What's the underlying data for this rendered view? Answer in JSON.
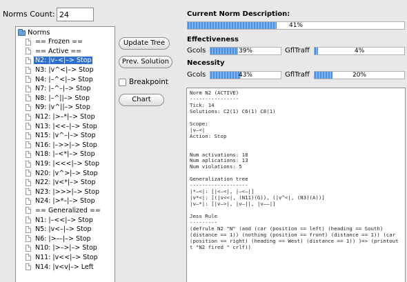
{
  "norms_count": {
    "label": "Norms Count:",
    "value": "24"
  },
  "tree": {
    "root_label": "Norms",
    "items": [
      {
        "label": "== Frozen ==",
        "selected": false
      },
      {
        "label": "== Active ==",
        "selected": false
      },
      {
        "label": "N2: |v–<|–> Stop",
        "selected": true
      },
      {
        "label": "N3: |v^<|–> Stop",
        "selected": false
      },
      {
        "label": "N4: |–^<|–> Stop",
        "selected": false
      },
      {
        "label": "N7: |–^–|–> Stop",
        "selected": false
      },
      {
        "label": "N8: |–^||–> Stop",
        "selected": false
      },
      {
        "label": "N9: |v^||–> Stop",
        "selected": false
      },
      {
        "label": "N12: |>–*|–> Stop",
        "selected": false
      },
      {
        "label": "N13: |<<–|–> Stop",
        "selected": false
      },
      {
        "label": "N15: |v^–|–> Stop",
        "selected": false
      },
      {
        "label": "N16: |–>>|–> Stop",
        "selected": false
      },
      {
        "label": "N18: |–<*|–> Stop",
        "selected": false
      },
      {
        "label": "N19: |<<<|–> Stop",
        "selected": false
      },
      {
        "label": "N20: |v^>|–> Stop",
        "selected": false
      },
      {
        "label": "N22: |v<*|–> Stop",
        "selected": false
      },
      {
        "label": "N23: |>>>|–> Stop",
        "selected": false
      },
      {
        "label": "N24: |>*–|–> Stop",
        "selected": false
      },
      {
        "label": "== Generalized ==",
        "selected": false
      },
      {
        "label": "N1: |–<<|–> Stop",
        "selected": false
      },
      {
        "label": "N5: |v<–|–> Stop",
        "selected": false
      },
      {
        "label": "N6: |>––|–> Stop",
        "selected": false
      },
      {
        "label": "N10: |>–>|–> Stop",
        "selected": false
      },
      {
        "label": "N11: |v<<|–> Stop",
        "selected": false
      },
      {
        "label": "N14: |v<v|–> Left",
        "selected": false
      }
    ]
  },
  "buttons": {
    "update_tree": "Update Tree",
    "prev_solution": "Prev. Solution",
    "chart": "Chart"
  },
  "breakpoint": {
    "label": "Breakpoint",
    "checked": false
  },
  "current_norm": {
    "title": "Current Norm Description:",
    "progress_text": "41%",
    "progress": 0.41
  },
  "effectiveness": {
    "title": "Effectiveness",
    "gcols": {
      "label": "Gcols",
      "text": "39%",
      "value": 0.39
    },
    "gfltraff": {
      "label": "GflTraff",
      "text": "4%",
      "value": 0.04
    }
  },
  "necessity": {
    "title": "Necessity",
    "gcols": {
      "label": "Gcols",
      "text": "43%",
      "value": 0.43
    },
    "gfltraff": {
      "label": "GflTraff",
      "text": "20%",
      "value": 0.2
    }
  },
  "description": {
    "text": "Norm N2 (ACTIVE)\n----------------\nTick: 14\nSolutions: C2(1) C6(1) C8(1)\n\nScope:\n|v–<|\nAction: Stop\n\n\nNum activations: 18\nNum aplications: 13\nNum violations: 5\n\nGeneralization tree\n-------------------\n|*–<|: [|<–<|, |–<–|]\n|v*<|: [(|v<<|, (N11)(G)), (|v^<|, (N3)(A))]\n|v–*|: [|v–>|, |v–||, |v––|]\n\nJess Rule\n---------\n(defrule N2 \"N\" (and (car (position == left) (heading == South) (distance == 1)) (nothing (position == front) (distance == 1)) (car (position == right) (heading == West) (distance == 1)) )=> (printout t \"N2 fired \" crlf))"
  }
}
